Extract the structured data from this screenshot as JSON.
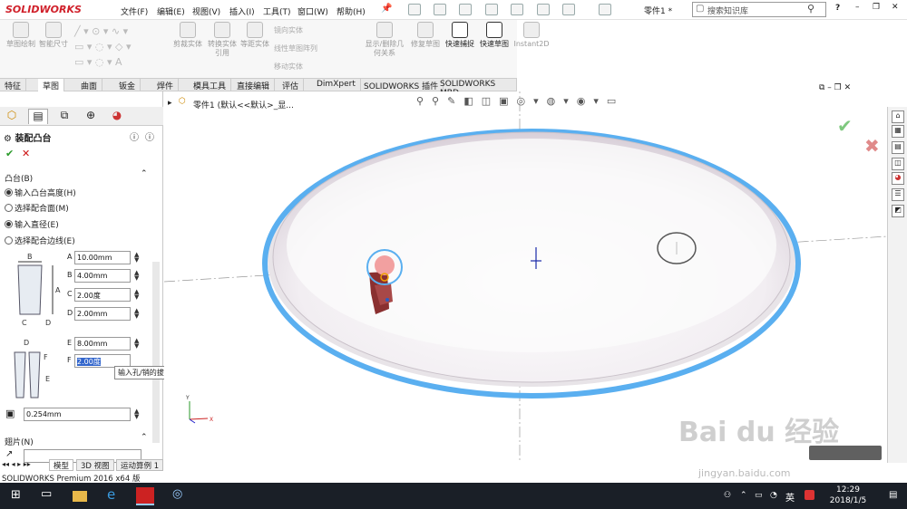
{
  "app": {
    "logo": "SOLIDWORKS",
    "menu": [
      "文件(F)",
      "编辑(E)",
      "视图(V)",
      "插入(I)",
      "工具(T)",
      "窗口(W)",
      "帮助(H)"
    ],
    "doc_title": "零件1 *",
    "search_placeholder": "搜索知识库"
  },
  "ribbon": {
    "buttons": [
      "草图绘制",
      "智能尺寸",
      "剪裁实体",
      "转换实体引用",
      "等距实体",
      "显示/删除几何关系",
      "修复草图",
      "快速捕捉",
      "快速草图",
      "Instant2D"
    ],
    "small": [
      "镜向实体",
      "线性草图阵列",
      "移动实体"
    ]
  },
  "tabs": [
    "特征",
    "草图",
    "曲面",
    "钣金",
    "焊件",
    "模具工具",
    "直接编辑",
    "评估",
    "DimXpert",
    "SOLIDWORKS 插件",
    "SOLIDWORKS MBD"
  ],
  "active_tab": "草图",
  "tree_breadcrumb": "零件1 (默认<<默认>_显...",
  "propertymanager": {
    "title": "装配凸台",
    "section_boss": "凸台(B)",
    "radios": [
      {
        "label": "输入凸台高度(H)",
        "on": true
      },
      {
        "label": "选择配合面(M)",
        "on": false
      },
      {
        "label": "输入直径(E)",
        "on": true
      },
      {
        "label": "选择配合边线(E)",
        "on": false
      }
    ],
    "dims": [
      {
        "key": "A",
        "value": "10.00mm"
      },
      {
        "key": "B",
        "value": "4.00mm"
      },
      {
        "key": "C",
        "value": "2.00度"
      },
      {
        "key": "D",
        "value": "2.00mm"
      },
      {
        "key": "E",
        "value": "8.00mm"
      },
      {
        "key": "F",
        "value": "2.00度"
      }
    ],
    "gap_value": "0.254mm",
    "section_fin": "翅片(N)",
    "tooltip": "输入孔/销的拔模角度"
  },
  "bottom_tabs": [
    "模型",
    "3D 视图",
    "运动算例 1"
  ],
  "status_text": "SOLIDWORKS Premium 2016 x64 版",
  "clock": {
    "time": "12:29",
    "date": "2018/1/5"
  },
  "ime": "英",
  "watermark": "jingyan.baidu.com"
}
